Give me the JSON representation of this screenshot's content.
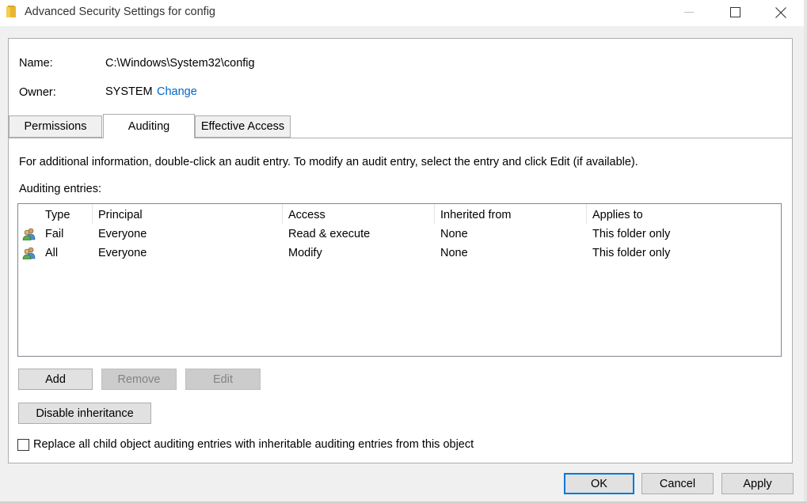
{
  "window": {
    "title": "Advanced Security Settings for config",
    "icon": "folder-icon"
  },
  "info": {
    "name_label": "Name:",
    "name_value": "C:\\Windows\\System32\\config",
    "owner_label": "Owner:",
    "owner_value": "SYSTEM",
    "change_link": "Change"
  },
  "tabs": [
    {
      "label": "Permissions",
      "active": false
    },
    {
      "label": "Auditing",
      "active": true
    },
    {
      "label": "Effective Access",
      "active": false
    }
  ],
  "auditing": {
    "description": "For additional information, double-click an audit entry. To modify an audit entry, select the entry and click Edit (if available).",
    "entries_label": "Auditing entries:",
    "columns": [
      "Type",
      "Principal",
      "Access",
      "Inherited from",
      "Applies to"
    ],
    "rows": [
      {
        "icon": "users-icon",
        "type": "Fail",
        "principal": "Everyone",
        "access": "Read & execute",
        "inherited_from": "None",
        "applies_to": "This folder only"
      },
      {
        "icon": "users-icon",
        "type": "All",
        "principal": "Everyone",
        "access": "Modify",
        "inherited_from": "None",
        "applies_to": "This folder only"
      }
    ]
  },
  "buttons": {
    "add": "Add",
    "remove": "Remove",
    "edit": "Edit",
    "disable_inheritance": "Disable inheritance",
    "ok": "OK",
    "cancel": "Cancel",
    "apply": "Apply"
  },
  "checkbox": {
    "label": "Replace all child object auditing entries with inheritable auditing entries from this object",
    "checked": false
  },
  "colors": {
    "accent": "#0078d7",
    "link": "#0066cc"
  }
}
